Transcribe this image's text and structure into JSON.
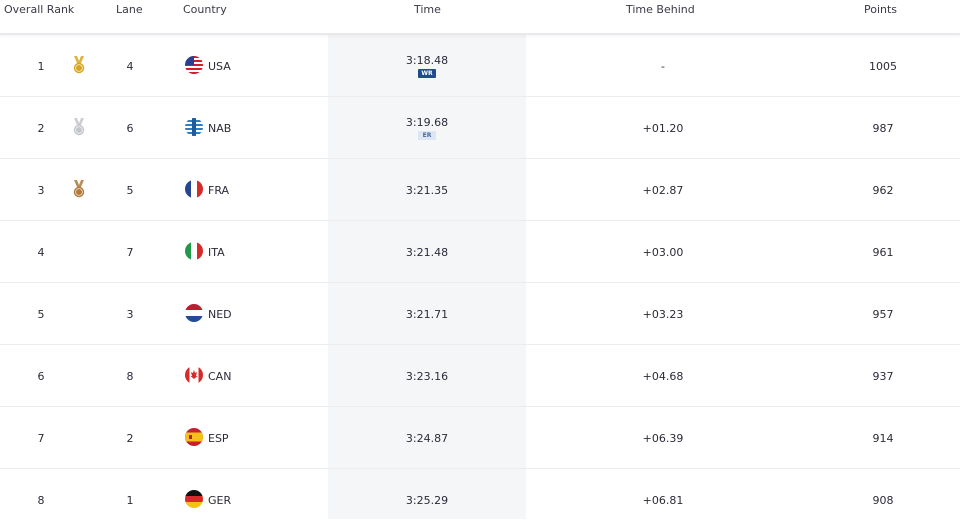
{
  "headers": {
    "overall_rank": "Overall Rank",
    "lane": "Lane",
    "country": "Country",
    "time": "Time",
    "time_behind": "Time Behind",
    "points": "Points"
  },
  "colors": {
    "gold": "#d9a520",
    "silver": "#c3c6cc",
    "bronze": "#b07a3a",
    "wr_badge": "#1f4b8f",
    "er_badge": "#dde6f3"
  },
  "rows": [
    {
      "rank": "1",
      "medal": "gold",
      "lane": "4",
      "flag": "usa-flag-icon",
      "country": "USA",
      "time": "3:18.48",
      "badge": "WR",
      "behind": "-",
      "points": "1005"
    },
    {
      "rank": "2",
      "medal": "silver",
      "lane": "6",
      "flag": "nab-flag-icon",
      "country": "NAB",
      "time": "3:19.68",
      "badge": "ER",
      "behind": "+01.20",
      "points": "987"
    },
    {
      "rank": "3",
      "medal": "bronze",
      "lane": "5",
      "flag": "fra-flag-icon",
      "country": "FRA",
      "time": "3:21.35",
      "badge": "",
      "behind": "+02.87",
      "points": "962"
    },
    {
      "rank": "4",
      "medal": "",
      "lane": "7",
      "flag": "ita-flag-icon",
      "country": "ITA",
      "time": "3:21.48",
      "badge": "",
      "behind": "+03.00",
      "points": "961"
    },
    {
      "rank": "5",
      "medal": "",
      "lane": "3",
      "flag": "ned-flag-icon",
      "country": "NED",
      "time": "3:21.71",
      "badge": "",
      "behind": "+03.23",
      "points": "957"
    },
    {
      "rank": "6",
      "medal": "",
      "lane": "8",
      "flag": "can-flag-icon",
      "country": "CAN",
      "time": "3:23.16",
      "badge": "",
      "behind": "+04.68",
      "points": "937"
    },
    {
      "rank": "7",
      "medal": "",
      "lane": "2",
      "flag": "esp-flag-icon",
      "country": "ESP",
      "time": "3:24.87",
      "badge": "",
      "behind": "+06.39",
      "points": "914"
    },
    {
      "rank": "8",
      "medal": "",
      "lane": "1",
      "flag": "ger-flag-icon",
      "country": "GER",
      "time": "3:25.29",
      "badge": "",
      "behind": "+06.81",
      "points": "908"
    }
  ]
}
